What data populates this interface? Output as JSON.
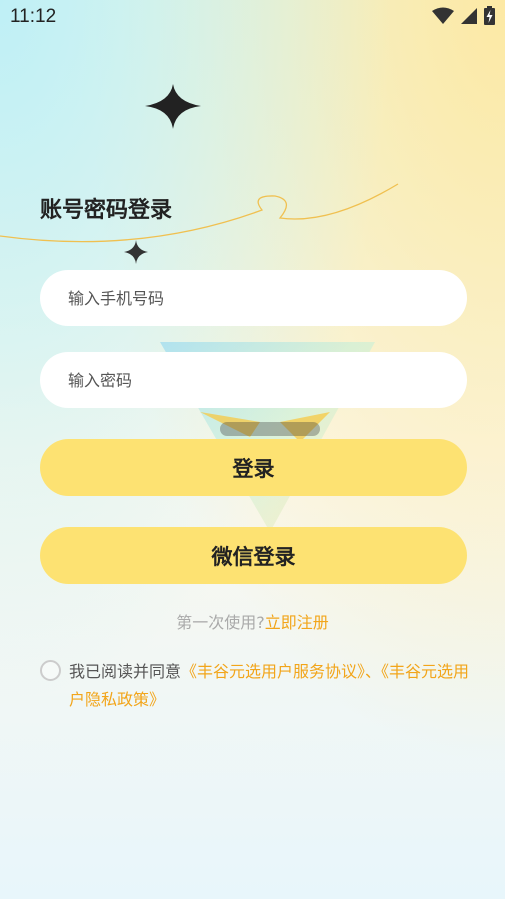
{
  "status_bar": {
    "time": "11:12"
  },
  "login": {
    "title": "账号密码登录",
    "phone_placeholder": "输入手机号码",
    "password_placeholder": "输入密码",
    "login_button": "登录",
    "wechat_button": "微信登录"
  },
  "register": {
    "prompt": "第一次使用?",
    "link": "立即注册"
  },
  "agreement": {
    "prefix": "我已阅读并同意",
    "service_link": "《丰谷元选用户服务协议》",
    "separator": "、",
    "privacy_link": "《丰谷元选用户隐私政策》"
  },
  "colors": {
    "accent": "#fde272",
    "link": "#f2a51a"
  },
  "icons": [
    "wifi-icon",
    "signal-icon",
    "battery-charging-icon",
    "sparkle-icon"
  ]
}
